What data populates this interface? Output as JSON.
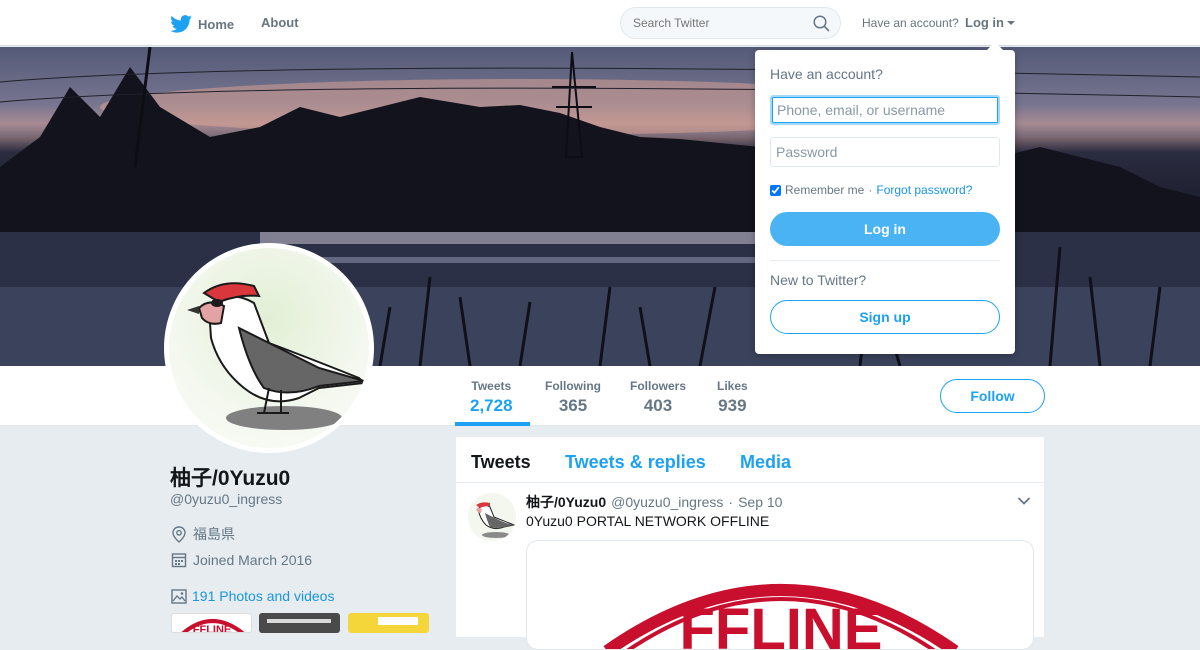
{
  "nav": {
    "home_label": "Home",
    "about_label": "About",
    "search_placeholder": "Search Twitter",
    "have_account": "Have an account?",
    "login_label": "Log in"
  },
  "profile": {
    "name": "柚子/0Yuzu0",
    "handle": "@0yuzu0_ingress",
    "location": "福島県",
    "joined": "Joined March 2016",
    "photos_label": "191 Photos and videos",
    "follow_label": "Follow"
  },
  "stats": [
    {
      "label": "Tweets",
      "value": "2,728"
    },
    {
      "label": "Following",
      "value": "365"
    },
    {
      "label": "Followers",
      "value": "403"
    },
    {
      "label": "Likes",
      "value": "939"
    }
  ],
  "tabs": [
    {
      "label": "Tweets"
    },
    {
      "label": "Tweets & replies"
    },
    {
      "label": "Media"
    }
  ],
  "tweet": {
    "author": "柚子/0Yuzu0",
    "handle": "@0yuzu0_ingress",
    "separator": "·",
    "date": "Sep 10",
    "text": "0Yuzu0 PORTAL NETWORK OFFLINE",
    "image_text": "FFLINE"
  },
  "thumb_text": "FFLINE",
  "login_dropdown": {
    "title": "Have an account?",
    "username_placeholder": "Phone, email, or username",
    "password_placeholder": "Password",
    "remember_label": "Remember me",
    "separator": "·",
    "forgot_label": "Forgot password?",
    "login_button": "Log in",
    "new_label": "New to Twitter?",
    "signup_button": "Sign up"
  },
  "colors": {
    "accent": "#1da1f2",
    "background": "#e6ecf0",
    "login_button": "#4ab3f4"
  }
}
